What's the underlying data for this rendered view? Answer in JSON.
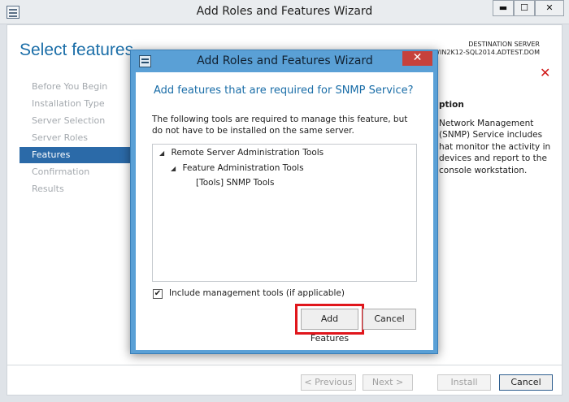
{
  "window": {
    "title": "Add Roles and Features Wizard",
    "controls": {
      "minimize": "▬",
      "maximize": "☐",
      "close": "✕"
    }
  },
  "page": {
    "title": "Select features",
    "destination_label": "DESTINATION SERVER",
    "destination_server": "WIN2K12-SQL2014.ADTEST.DOM"
  },
  "nav": {
    "items": [
      {
        "label": "Before You Begin",
        "active": false
      },
      {
        "label": "Installation Type",
        "active": false
      },
      {
        "label": "Server Selection",
        "active": false
      },
      {
        "label": "Server Roles",
        "active": false
      },
      {
        "label": "Features",
        "active": true
      },
      {
        "label": "Confirmation",
        "active": false
      },
      {
        "label": "Results",
        "active": false
      }
    ]
  },
  "description": {
    "title": "ption",
    "lines": [
      "Network Management",
      "(SNMP) Service includes",
      "hat monitor the activity in",
      "devices and report to the",
      "console workstation."
    ]
  },
  "footer": {
    "previous": "< Previous",
    "next": "Next >",
    "install": "Install",
    "cancel": "Cancel"
  },
  "dialog": {
    "title": "Add Roles and Features Wizard",
    "close_glyph": "✕",
    "heading": "Add features that are required for SNMP Service?",
    "text": "The following tools are required to manage this feature, but do not have to be installed on the same server.",
    "tree": [
      {
        "label": "Remote Server Administration Tools",
        "expanded": true
      },
      {
        "label": "Feature Administration Tools",
        "expanded": true
      },
      {
        "label": "[Tools] SNMP Tools",
        "expanded": false
      }
    ],
    "include_tools_label": "Include management tools (if applicable)",
    "include_tools_checked": true,
    "add_button": "Add Features",
    "cancel_button": "Cancel"
  },
  "colors": {
    "accent": "#1b6ea8",
    "nav_active": "#2b6aa8",
    "dialog_frame": "#5aa0d6",
    "close_red": "#c6413c",
    "highlight_red": "#e0161c"
  }
}
